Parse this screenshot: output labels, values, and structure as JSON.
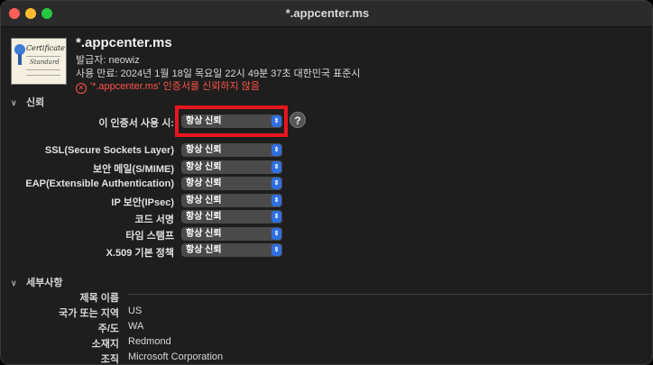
{
  "window": {
    "title": "*.appcenter.ms"
  },
  "cert": {
    "icon_title": "Certificate",
    "icon_subtitle": "Standard",
    "name": "*.appcenter.ms",
    "issuer": "발급자: neowiz",
    "expires": "사용 만료: 2024년 1월 18일 목요일 22시 49분 37초 대한민국 표준시",
    "warning": "'*.appcenter.ms' 인증서를 신뢰하지 않음"
  },
  "trust": {
    "header": "신뢰",
    "when_using_label": "이 인증서 사용 시:",
    "when_using_value": "항상 신뢰",
    "help": "?",
    "rows": [
      {
        "label": "SSL(Secure Sockets Layer)",
        "value": "항상 신뢰"
      },
      {
        "label": "보안 메일(S/MIME)",
        "value": "항상 신뢰"
      },
      {
        "label": "EAP(Extensible Authentication)",
        "value": "항상 신뢰"
      },
      {
        "label": "IP 보안(IPsec)",
        "value": "항상 신뢰"
      },
      {
        "label": "코드 서명",
        "value": "항상 신뢰"
      },
      {
        "label": "타임 스탬프",
        "value": "항상 신뢰"
      },
      {
        "label": "X.509 기본 정책",
        "value": "항상 신뢰"
      }
    ]
  },
  "details": {
    "header": "세부사항",
    "subject_name_label": "제목 이름",
    "rows": [
      {
        "label": "국가 또는 지역",
        "value": "US"
      },
      {
        "label": "주/도",
        "value": "WA"
      },
      {
        "label": "소재지",
        "value": "Redmond"
      },
      {
        "label": "조직",
        "value": "Microsoft Corporation"
      }
    ]
  }
}
